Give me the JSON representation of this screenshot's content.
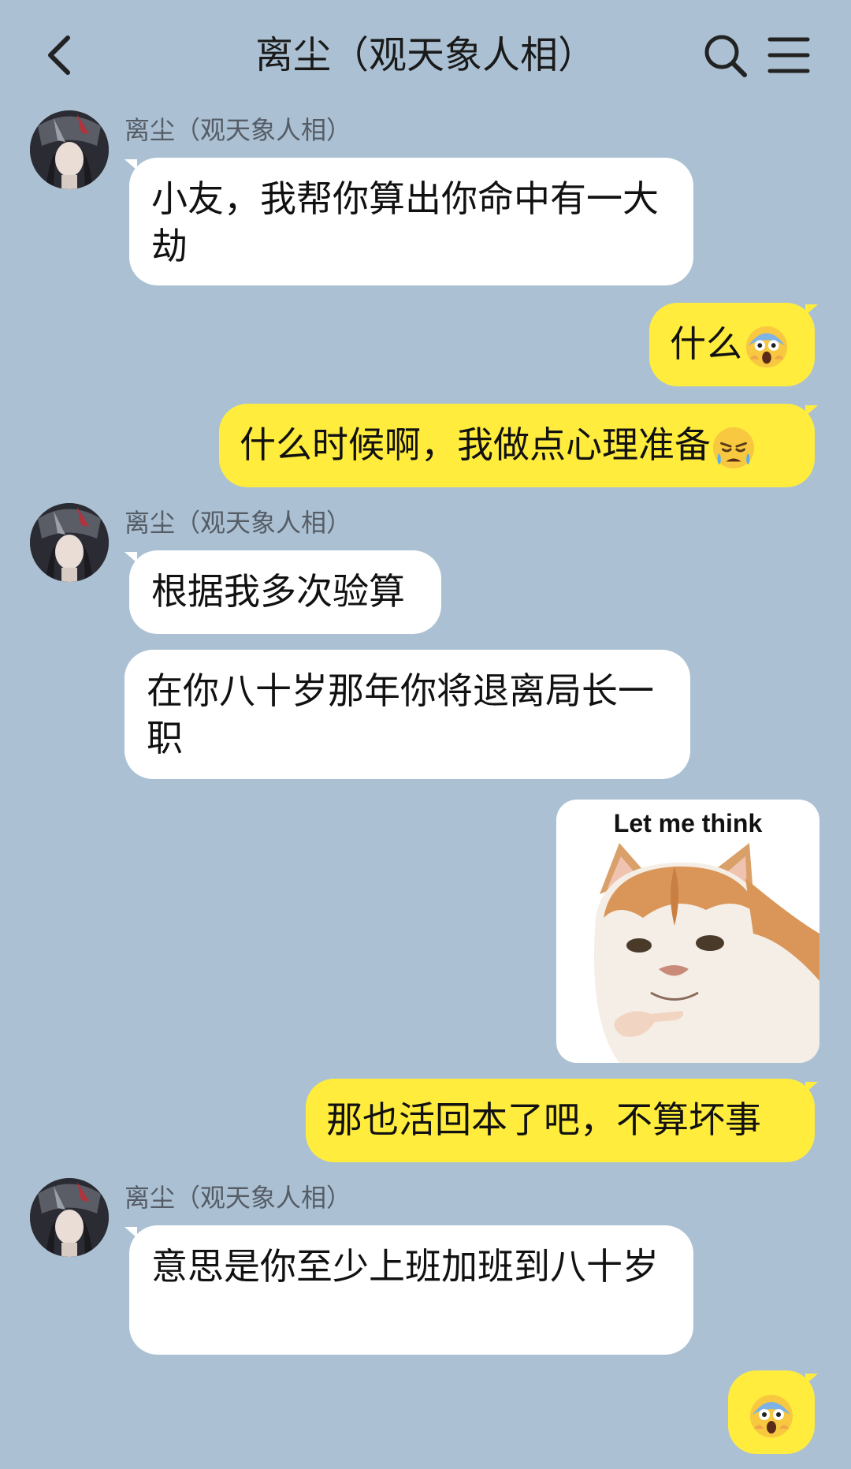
{
  "header": {
    "title": "离尘（观天象人相）",
    "back_icon": "chevron-left-icon",
    "search_icon": "search-icon",
    "menu_icon": "hamburger-menu-icon"
  },
  "contact": {
    "name": "离尘（观天象人相）"
  },
  "messages": [
    {
      "from": "contact",
      "text": "小友，我帮你算出你命中有一大劫"
    },
    {
      "from": "me",
      "text": "什么",
      "emoji": "screaming-face-emoji"
    },
    {
      "from": "me",
      "text": "什么时候啊，我做点心理准备",
      "emoji": "worried-tearful-face-emoji"
    },
    {
      "from": "contact",
      "text": "根据我多次验算"
    },
    {
      "from": "contact",
      "text": "在你八十岁那年你将退离局长一职"
    },
    {
      "from": "me",
      "type": "sticker",
      "caption": "Let me think",
      "image": "cat-pointing-sticker"
    },
    {
      "from": "me",
      "text": "那也活回本了吧，不算坏事"
    },
    {
      "from": "contact",
      "text": "意思是你至少上班加班到八十岁"
    },
    {
      "from": "me",
      "text": "",
      "emoji": "screaming-face-emoji"
    }
  ],
  "colors": {
    "background": "#abc1d3",
    "incoming_bubble": "#ffffff",
    "outgoing_bubble": "#ffec3d"
  }
}
